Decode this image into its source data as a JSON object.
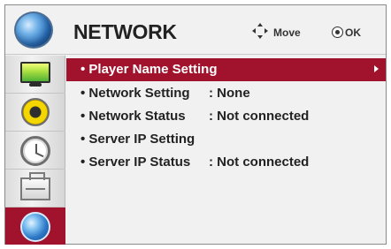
{
  "header": {
    "title": "NETWORK",
    "move_label": "Move",
    "ok_label": "OK",
    "icon": "network-globe-icon"
  },
  "sidebar": {
    "items": [
      {
        "name": "picture",
        "icon": "tv-icon",
        "active": false
      },
      {
        "name": "audio",
        "icon": "speaker-icon",
        "active": false
      },
      {
        "name": "time",
        "icon": "clock-icon",
        "active": false
      },
      {
        "name": "option",
        "icon": "toolbox-icon",
        "active": false
      },
      {
        "name": "network",
        "icon": "globe-icon",
        "active": true
      }
    ]
  },
  "menu": {
    "items": [
      {
        "label": "• Player Name Setting",
        "value": "",
        "selected": true
      },
      {
        "label": "• Network Setting",
        "value": ": None",
        "selected": false
      },
      {
        "label": "• Network Status",
        "value": ": Not connected",
        "selected": false
      },
      {
        "label": "• Server IP Setting",
        "value": "",
        "selected": false
      },
      {
        "label": "• Server IP Status",
        "value": ": Not connected",
        "selected": false
      }
    ]
  },
  "colors": {
    "accent": "#a1122c",
    "background": "#f1f1f1",
    "text": "#222222"
  }
}
